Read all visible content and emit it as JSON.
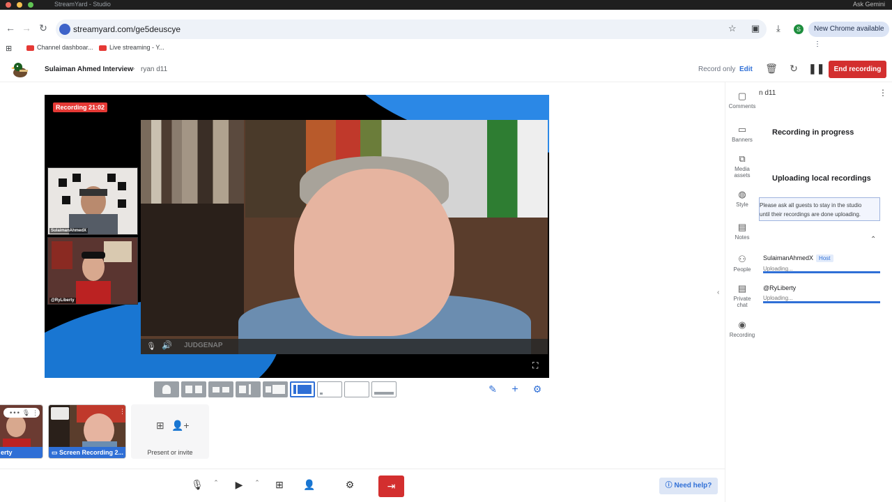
{
  "browser": {
    "tab_title": "StreamYard - Studio",
    "ask_label": "Ask Gemini",
    "url": "streamyard.com/ge5deuscye",
    "profile_initial": "S",
    "new_chrome_label": "New Chrome available",
    "bookmarks": [
      {
        "label": "Channel dashboar..."
      },
      {
        "label": "Live streaming - Y..."
      }
    ]
  },
  "header": {
    "project": "Sulaiman Ahmed Interview",
    "separator": "›",
    "session": "ryan d11",
    "record_only": "Record only",
    "edit": "Edit",
    "end_recording": "End recording"
  },
  "stage": {
    "recording_badge": "Recording 21:02",
    "guests": [
      {
        "label": "SulaimanAhmedX"
      },
      {
        "label": "@RyLiberty"
      }
    ],
    "main_handle": "JUDGENAP"
  },
  "tray": {
    "tiles": [
      {
        "label": "erty"
      },
      {
        "label": "Screen Recording 2..."
      }
    ],
    "present_label": "Present or invite"
  },
  "bottom": {
    "need_help": "Need help?"
  },
  "sidebar": {
    "tabs": [
      {
        "label": "Comments",
        "icon": "comment-icon"
      },
      {
        "label": "Banners",
        "icon": "banner-icon"
      },
      {
        "label": "Media assets",
        "icon": "media-icon"
      },
      {
        "label": "Style",
        "icon": "palette-icon"
      },
      {
        "label": "Notes",
        "icon": "notes-icon"
      },
      {
        "label": "People",
        "icon": "people-icon"
      },
      {
        "label": "Private chat",
        "icon": "chat-icon"
      },
      {
        "label": "Recording",
        "icon": "record-icon"
      }
    ],
    "panel_title": "n d11",
    "cards": {
      "recording_title": "Recording in progress",
      "uploading_title": "Uploading local recordings",
      "notice_line1": "Please ask all guests to stay in the studio",
      "notice_line2": "until their recordings are done uploading."
    },
    "participants": [
      {
        "name": "SulaimanAhmedX",
        "badge": "Host",
        "status": "Uploading...",
        "progress": 1.0
      },
      {
        "name": "@RyLiberty",
        "badge": "",
        "status": "Uploading...",
        "progress": 1.0
      }
    ]
  },
  "colors": {
    "brand_blue": "#2f6fd6",
    "end_red": "#d32f2f"
  }
}
